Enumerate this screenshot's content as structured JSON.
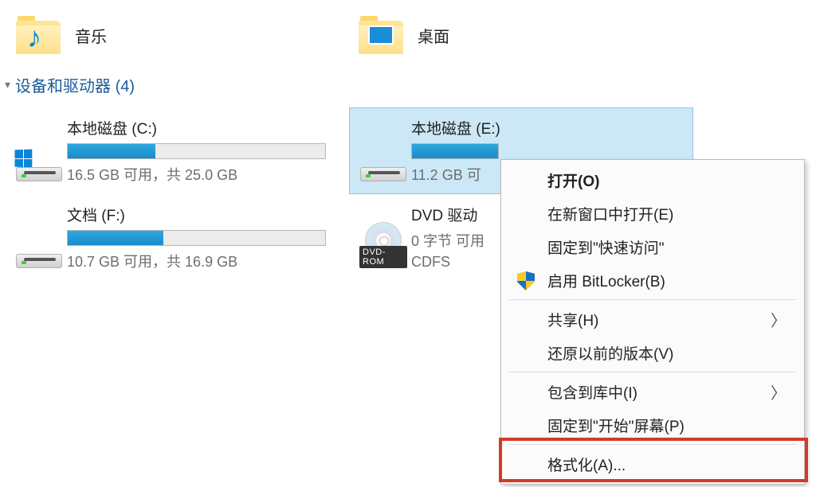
{
  "folders": {
    "music": "音乐",
    "desktop": "桌面"
  },
  "section": {
    "title": "设备和驱动器 (4)"
  },
  "drives": {
    "c": {
      "label": "本地磁盘 (C:)",
      "info": "16.5 GB 可用，共 25.0 GB",
      "fill_pct": 34
    },
    "e": {
      "label": "本地磁盘 (E:)",
      "info": "11.2 GB 可",
      "fill_pct": 37
    },
    "f": {
      "label": "文档 (F:)",
      "info": "10.7 GB 可用，共 16.9 GB",
      "fill_pct": 37
    },
    "dvd": {
      "label": "DVD 驱动",
      "line2": "0 字节 可用",
      "fs": "CDFS",
      "badge": "DVD-ROM"
    }
  },
  "menu": {
    "open": "打开(O)",
    "open_new": "在新窗口中打开(E)",
    "pin_quick": "固定到\"快速访问\"",
    "bitlocker": "启用 BitLocker(B)",
    "share": "共享(H)",
    "restore": "还原以前的版本(V)",
    "include_lib": "包含到库中(I)",
    "pin_start": "固定到\"开始\"屏幕(P)",
    "format": "格式化(A)..."
  }
}
